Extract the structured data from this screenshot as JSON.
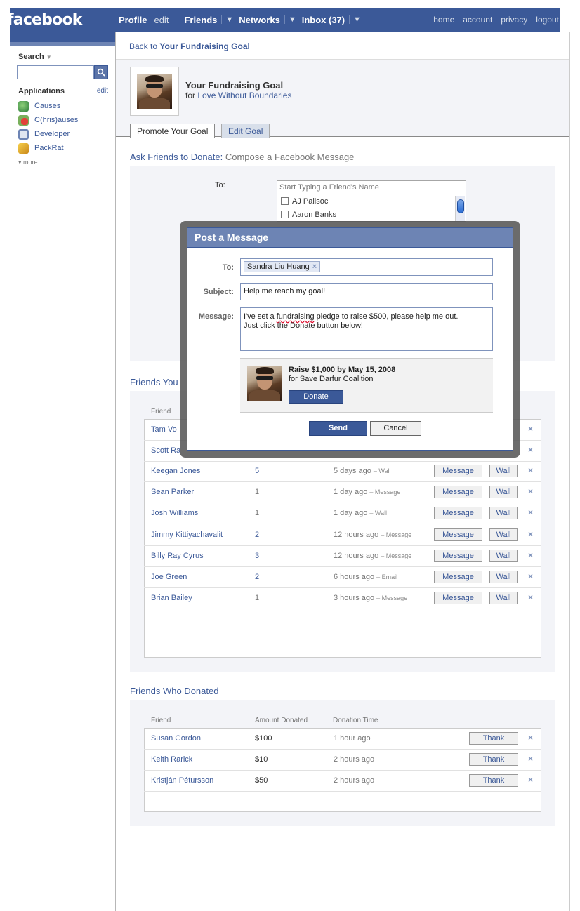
{
  "topnav": {
    "logo": "facebook",
    "profile": "Profile",
    "edit": "edit",
    "friends": "Friends",
    "networks": "Networks",
    "inbox": "Inbox (37)",
    "caret": "▼",
    "right": [
      "home",
      "account",
      "privacy",
      "logout"
    ]
  },
  "sidebar": {
    "search_label": "Search",
    "search_caret": "▼",
    "apps_label": "Applications",
    "apps_edit": "edit",
    "apps": [
      {
        "label": "Causes",
        "icon": "causes-icon"
      },
      {
        "label": "C(hris)auses",
        "icon": "chrisauses-icon"
      },
      {
        "label": "Developer",
        "icon": "developer-icon"
      },
      {
        "label": "PackRat",
        "icon": "packrat-icon"
      }
    ],
    "more": "▾ more"
  },
  "header": {
    "back_prefix": "Back to",
    "back_link": "Your Fundraising Goal",
    "goal_title": "Your Fundraising Goal",
    "goal_for_prefix": "for",
    "goal_for_link": "Love Without Boundaries",
    "tabs": [
      "Promote Your Goal",
      "Edit Goal"
    ]
  },
  "compose": {
    "title": "Ask Friends to Donate:",
    "subtitle": "Compose a Facebook Message",
    "to_label": "To:",
    "input_placeholder": "Start Typing a Friend's Name",
    "friends": [
      "AJ Palisoc",
      "Aaron Banks"
    ]
  },
  "asked": {
    "title_visible": "Friends You",
    "col_friend": "Friend",
    "rows": [
      {
        "name": "Tam Vo",
        "count": "",
        "time": "",
        "via": "",
        "partial": true
      },
      {
        "name": "Scott Ra",
        "count": "",
        "time": "",
        "via": "",
        "partial": true
      },
      {
        "name": "Keegan Jones",
        "count": "5",
        "time": "5 days ago",
        "via": "– Wall"
      },
      {
        "name": "Sean Parker",
        "count": "1",
        "time": "1 day ago",
        "via": "– Message"
      },
      {
        "name": "Josh Williams",
        "count": "1",
        "time": "1 day ago",
        "via": "– Wall"
      },
      {
        "name": "Jimmy Kittiyachavalit",
        "count": "2",
        "time": "12 hours ago",
        "via": "– Message"
      },
      {
        "name": "Billy Ray Cyrus",
        "count": "3",
        "time": "12 hours ago",
        "via": "– Message"
      },
      {
        "name": "Joe Green",
        "count": "2",
        "time": "6 hours ago",
        "via": "– Email"
      },
      {
        "name": "Brian Bailey",
        "count": "1",
        "time": "3 hours ago",
        "via": "– Message"
      }
    ],
    "message_btn": "Message",
    "wall_btn": "Wall",
    "remove": "×"
  },
  "donated": {
    "title": "Friends Who Donated",
    "col_friend": "Friend",
    "col_amount": "Amount Donated",
    "col_time": "Donation Time",
    "rows": [
      {
        "name": "Susan Gordon",
        "amount": "$100",
        "time": "1 hour ago"
      },
      {
        "name": "Keith Rarick",
        "amount": "$10",
        "time": "2 hours ago"
      },
      {
        "name": "Kristján Pétursson",
        "amount": "$50",
        "time": "2 hours ago"
      }
    ],
    "thank_btn": "Thank",
    "remove": "×"
  },
  "modal": {
    "title": "Post a Message",
    "to_label": "To:",
    "to_token": "Sandra Liu Huang",
    "token_remove": "×",
    "subject_label": "Subject:",
    "subject_value": "Help me reach my goal!",
    "message_label": "Message:",
    "message_pre": "I've set a",
    "message_word": "fundraising",
    "message_post": "pledge to raise $500, please help me out.",
    "message_line2": "Just click the Donate button below!",
    "attach_title": "Raise $1,000 by May 15, 2008",
    "attach_for": "for Save Darfur Coalition",
    "donate_btn": "Donate",
    "send_btn": "Send",
    "cancel_btn": "Cancel"
  },
  "colors": {
    "brand": "#3b5998",
    "brand_light": "#6d84b4",
    "panel_bg": "#f3f4f8"
  }
}
